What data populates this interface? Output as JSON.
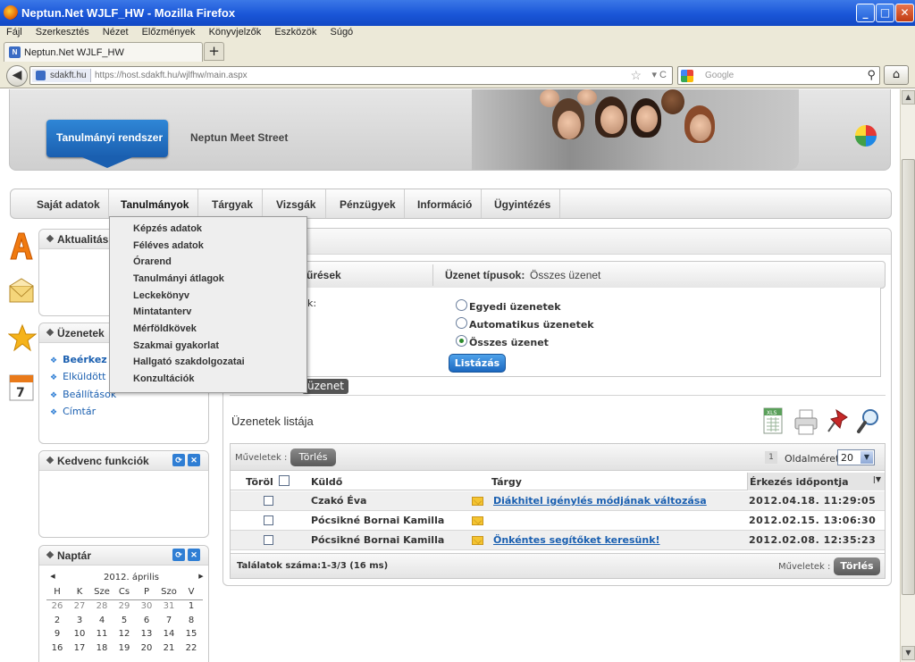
{
  "window": {
    "title": "Neptun.Net WJLF_HW - Mozilla Firefox"
  },
  "menubar": [
    "Fájl",
    "Szerkesztés",
    "Nézet",
    "Előzmények",
    "Könyvjelzők",
    "Eszközök",
    "Súgó"
  ],
  "tab": {
    "label": "Neptun.Net WJLF_HW",
    "new_tab": "+"
  },
  "navbar": {
    "site": "sdakft.hu",
    "url": "https://host.sdakft.hu/wjlfhw/main.aspx",
    "search_placeholder": "Google"
  },
  "header": {
    "system_badge": "Tanulmányi rendszer",
    "meet_street": "Neptun Meet Street"
  },
  "mainnav": [
    "Saját adatok",
    "Tanulmányok",
    "Tárgyak",
    "Vizsgák",
    "Pénzügyek",
    "Információ",
    "Ügyintézés"
  ],
  "dropdown": [
    "Képzés adatok",
    "Féléves adatok",
    "Órarend",
    "Tanulmányi átlagok",
    "Leckekönyv",
    "Mintatanterv",
    "Mérföldkövek",
    "Szakmai gyakorlat",
    "Hallgató szakdolgozatai",
    "Konzultációk"
  ],
  "left": {
    "news_title": "Aktualitás",
    "messages_title": "Üzenetek",
    "message_links": [
      "Beérkez",
      "Elküldött ü",
      "Beállítások",
      "Címtár"
    ],
    "favorites_title": "Kedvenc funkciók",
    "calendar_title": "Naptár",
    "calendar": {
      "month": "2012. április",
      "prev": "◀",
      "next": "▶",
      "weekdays": [
        "H",
        "K",
        "Sze",
        "Cs",
        "P",
        "Szo",
        "V"
      ],
      "weeks": [
        [
          "26",
          "27",
          "28",
          "29",
          "30",
          "31",
          "1"
        ],
        [
          "2",
          "3",
          "4",
          "5",
          "6",
          "7",
          "8"
        ],
        [
          "9",
          "10",
          "11",
          "12",
          "13",
          "14",
          "15"
        ],
        [
          "16",
          "17",
          "18",
          "19",
          "20",
          "21",
          "22"
        ]
      ]
    }
  },
  "filter": {
    "left_label": "űrések",
    "type_label": "Üzenet típusok:",
    "type_value": "Összes üzenet",
    "partial_label": "k:",
    "radios": [
      {
        "label": "Egyedi üzenetek",
        "checked": false
      },
      {
        "label": "Automatikus üzenetek",
        "checked": false
      },
      {
        "label": "Összes üzenet",
        "checked": true
      }
    ],
    "list_button": "Listázás"
  },
  "new_message_button": "üzenet",
  "list": {
    "title": "Üzenetek listája",
    "actions_label": "Műveletek :",
    "delete_button": "Törlés",
    "page_number": "1",
    "page_size_label": "Oldalméret",
    "page_size": "20",
    "columns": {
      "delete": "Töröl",
      "sender": "Küldő",
      "subject": "Tárgy",
      "arrival": "Érkezés időpontja"
    },
    "rows": [
      {
        "sender": "Czakó Éva",
        "subject": "Diákhitel igénylés módjának változása",
        "date": "2012.04.18. 11:29:05"
      },
      {
        "sender": "Pócsikné Bornai Kamilla",
        "subject": "",
        "date": "2012.02.15. 13:06:30"
      },
      {
        "sender": "Pócsikné Bornai Kamilla",
        "subject": "Önkéntes segítőket keresünk!",
        "date": "2012.02.08. 12:35:23"
      }
    ],
    "results": "Találatok száma:1-3/3 (16 ms)",
    "footer_actions_label": "Műveletek :",
    "footer_delete_button": "Törlés"
  }
}
